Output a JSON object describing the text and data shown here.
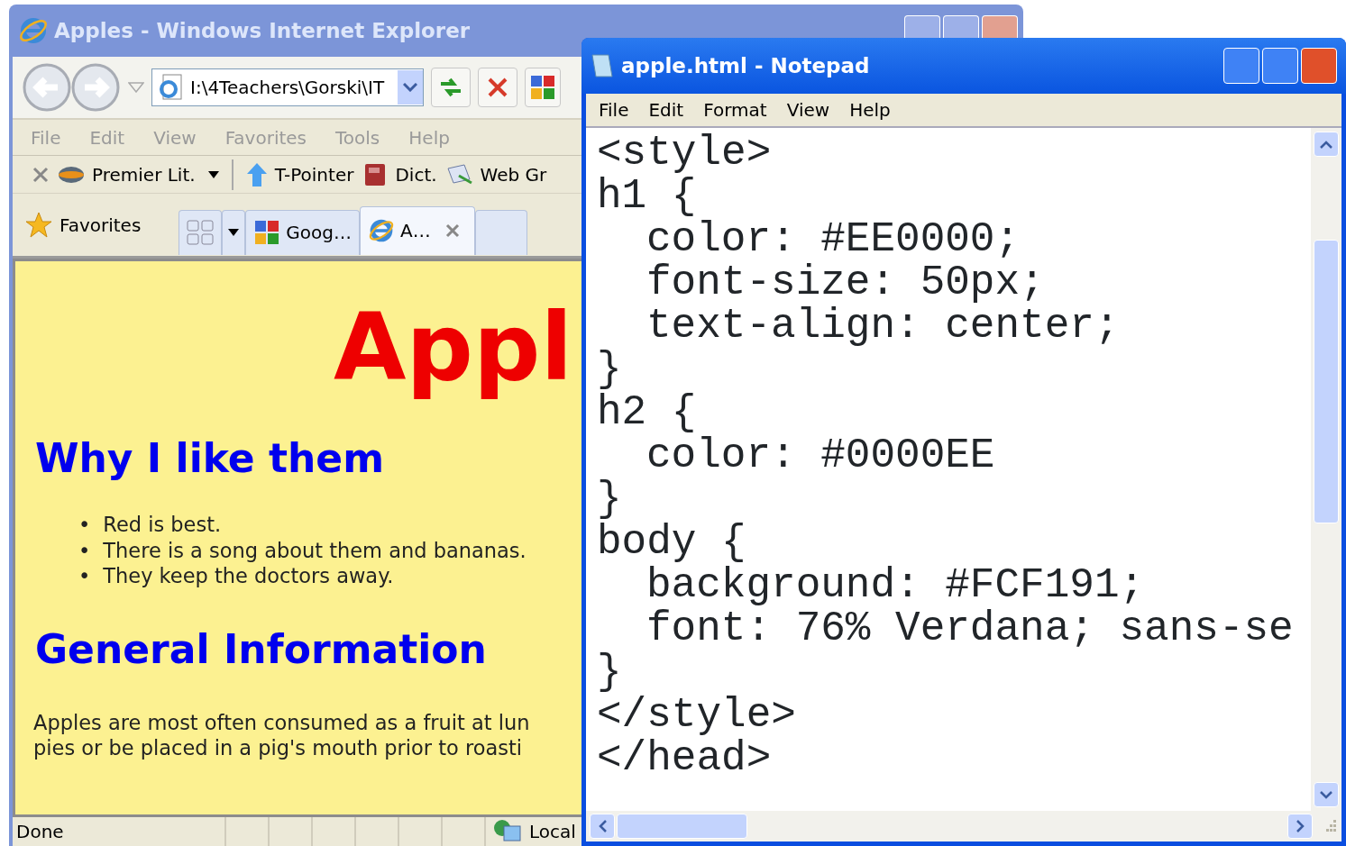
{
  "browser": {
    "title": "Apples - Windows Internet Explorer",
    "address": "I:\\4Teachers\\Gorski\\IT",
    "menu": [
      "File",
      "Edit",
      "View",
      "Favorites",
      "Tools",
      "Help"
    ],
    "links": [
      {
        "label": "Premier Lit.",
        "dropdown": true
      },
      {
        "label": "T-Pointer",
        "dropdown": false
      },
      {
        "label": "Dict.",
        "dropdown": false
      },
      {
        "label": "Web Gr",
        "dropdown": false
      }
    ],
    "favorites": "Favorites",
    "tabs": [
      {
        "label": "Goog…",
        "selected": false
      },
      {
        "label": "A…",
        "selected": true
      }
    ],
    "page": {
      "title": "Appl",
      "sections": [
        {
          "heading": "Why I like them",
          "kind": "list",
          "items": [
            {
              "bullet": "•",
              "text": "Red is best."
            },
            {
              "bullet": "•",
              "text": "There is a song about them and bananas."
            },
            {
              "bullet": "•",
              "text": "They keep the doctors away."
            }
          ]
        },
        {
          "heading": "General Information",
          "kind": "paragraph",
          "items": [
            "Apples are most often consumed as a fruit at lun",
            "pies or be placed in a pig's mouth prior to roasti"
          ]
        }
      ]
    },
    "status": "Done",
    "zone": "Local"
  },
  "notepad": {
    "title": "apple.html - Notepad",
    "menu": [
      "File",
      "Edit",
      "Format",
      "View",
      "Help"
    ],
    "lines": [
      {
        "text": "<style>",
        "indented": false
      },
      {
        "text": "h1 {",
        "indented": false
      },
      {
        "text": "color: #EE0000;",
        "indented": true
      },
      {
        "text": "font-size: 50px;",
        "indented": true
      },
      {
        "text": "text-align: center;",
        "indented": true
      },
      {
        "text": "}",
        "indented": false
      },
      {
        "text": "h2 {",
        "indented": false
      },
      {
        "text": "color: #0000EE",
        "indented": true
      },
      {
        "text": "}",
        "indented": false
      },
      {
        "text": "body {",
        "indented": false
      },
      {
        "text": "background: #FCF191;",
        "indented": true
      },
      {
        "text": "font: 76% Verdana; sans-se",
        "indented": true
      },
      {
        "text": "}",
        "indented": false
      },
      {
        "text": "</style>",
        "indented": false
      },
      {
        "text": "</head>",
        "indented": false
      }
    ]
  }
}
